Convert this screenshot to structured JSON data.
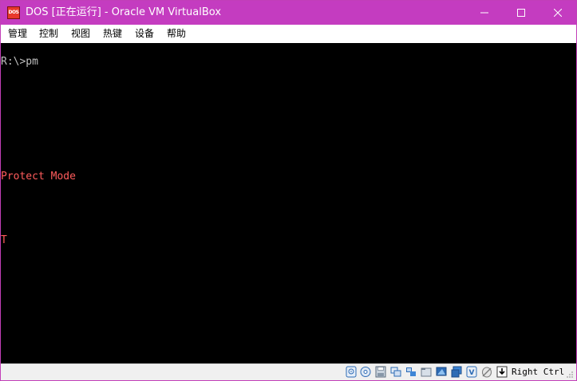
{
  "window": {
    "title": "DOS [正在运行] - Oracle VM VirtualBox",
    "app_icon_text": "DOS",
    "title_bar_color": "#c43cc0",
    "minimize_symbol": "—",
    "maximize_symbol": "☐",
    "close_symbol": "✕"
  },
  "menu": {
    "items": [
      "管理",
      "控制",
      "视图",
      "热键",
      "设备",
      "帮助"
    ]
  },
  "console": {
    "lines": [
      {
        "text": "R:\\>pm",
        "color": "#c0c0c0"
      },
      {
        "text": "Protect Mode",
        "color": "#ff5c5c"
      },
      {
        "text": "T",
        "color": "#ff5c5c"
      }
    ]
  },
  "statusbar": {
    "icons": [
      "hard-disk-icon",
      "optical-drive-icon",
      "floppy-icon",
      "usb-icon",
      "network-icon",
      "shared-folder-icon",
      "display-icon",
      "video-capture-icon",
      "cpu-icon",
      "mouse-integration-icon",
      "keyboard-icon"
    ],
    "host_key": "Right Ctrl"
  }
}
